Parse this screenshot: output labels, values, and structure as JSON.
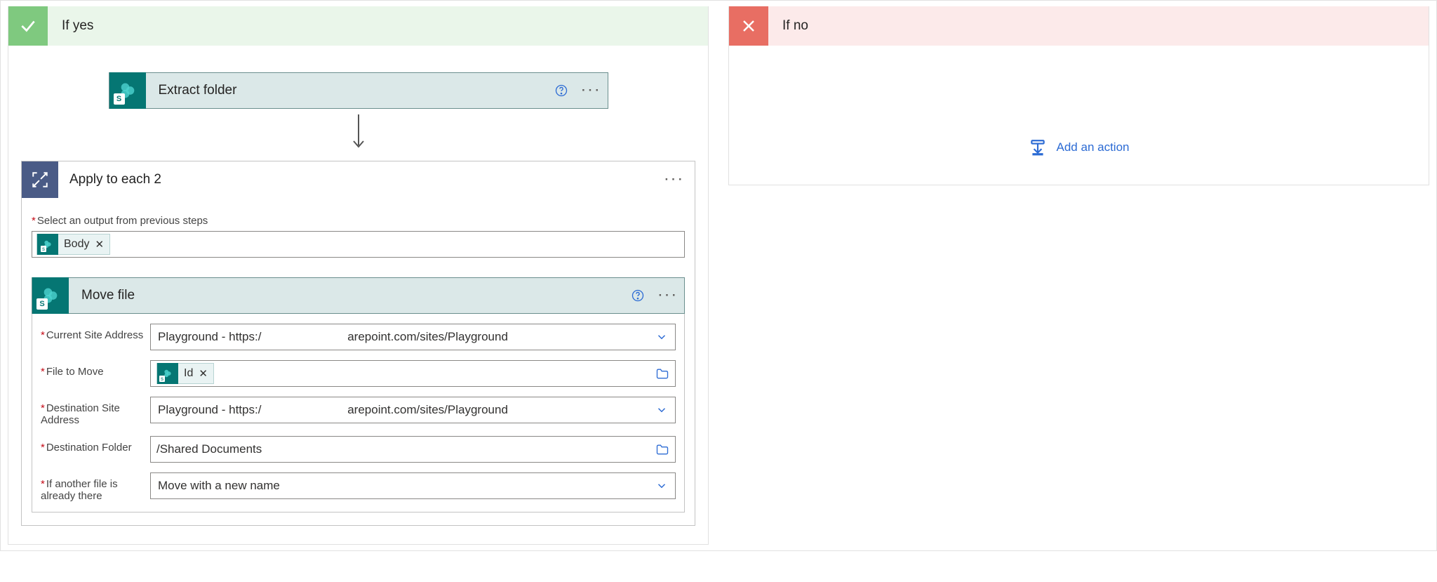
{
  "yes": {
    "title": "If yes",
    "extract": {
      "title": "Extract folder"
    },
    "loop": {
      "title": "Apply to each 2",
      "output_label": "Select an output from previous steps",
      "output_token": "Body"
    },
    "move": {
      "title": "Move file",
      "fields": {
        "current_site_label": "Current Site Address",
        "current_site_value": "Playground - https:/                          arepoint.com/sites/Playground",
        "file_to_move_label": "File to Move",
        "file_to_move_token": "Id",
        "dest_site_label": "Destination Site Address",
        "dest_site_value": "Playground - https:/                          arepoint.com/sites/Playground",
        "dest_folder_label": "Destination Folder",
        "dest_folder_value": "/Shared Documents",
        "overwrite_label": "If another file is already there",
        "overwrite_value": "Move with a new name"
      }
    }
  },
  "no": {
    "title": "If no",
    "add_action": "Add an action"
  }
}
